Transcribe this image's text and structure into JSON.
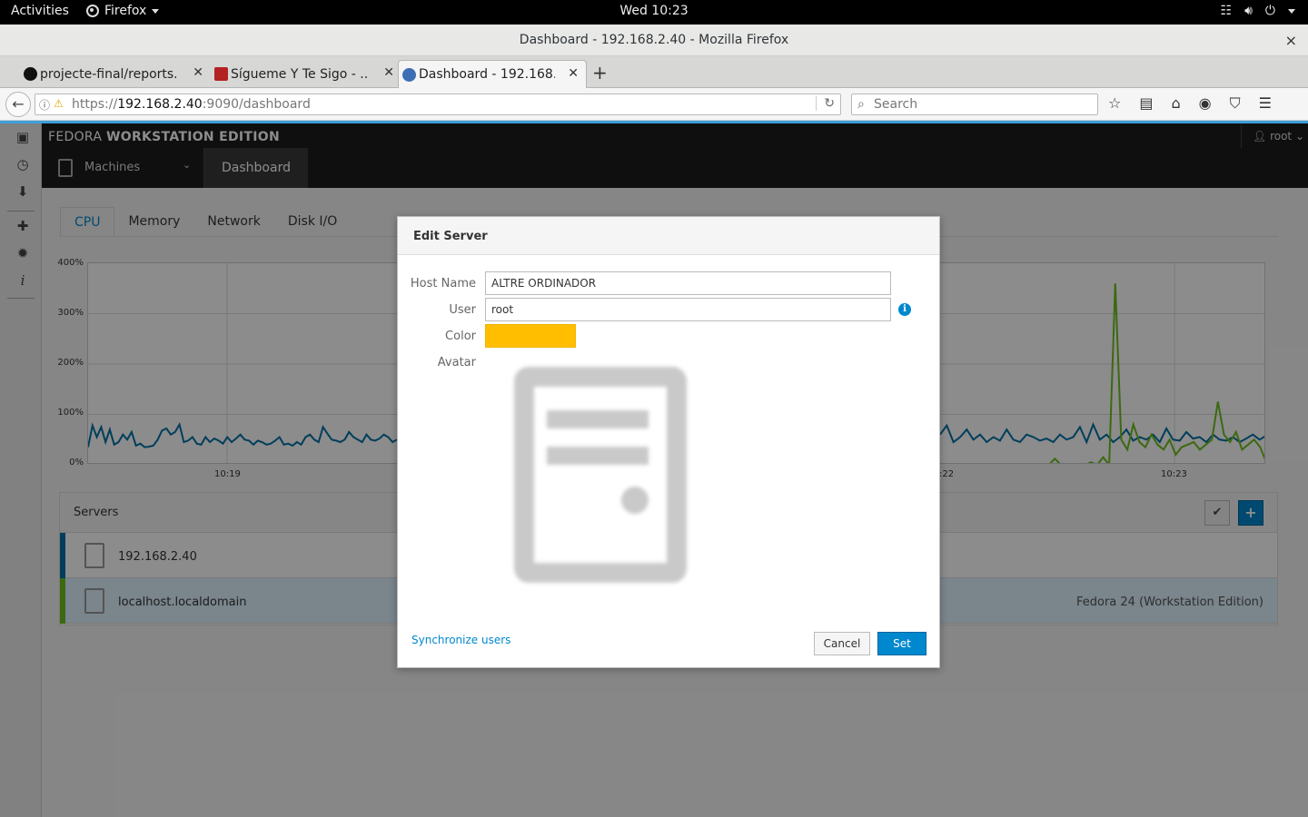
{
  "topbar": {
    "activities": "Activities",
    "app": "Firefox",
    "clock": "Wed 10:23"
  },
  "window": {
    "title": "Dashboard - 192.168.2.40 - Mozilla Firefox",
    "close": "×"
  },
  "tabs": [
    {
      "label": "projecte-final/reports...",
      "favicon": "github-icon",
      "color": "#111111"
    },
    {
      "label": "Sígueme Y Te Sigo - ...",
      "favicon": "site-icon",
      "color": "#b22222"
    },
    {
      "label": "Dashboard - 192.168....",
      "favicon": "fedora-icon",
      "color": "#3c6eb4"
    }
  ],
  "navbar": {
    "url_prefix": "https://",
    "url_host": "192.168.2.40",
    "url_rest": ":9090/dashboard",
    "search_placeholder": "Search"
  },
  "cockpit": {
    "brand_light": "FEDORA ",
    "brand_bold": "WORKSTATION EDITION",
    "user": "root",
    "machines": "Machines",
    "dashboard": "Dashboard",
    "content_tabs": [
      "CPU",
      "Memory",
      "Network",
      "Disk I/O"
    ],
    "active_tab": "CPU"
  },
  "chart_data": {
    "type": "line",
    "y_ticks": [
      "400%",
      "300%",
      "200%",
      "100%",
      "0%"
    ],
    "x_ticks": [
      "10:19",
      ":22",
      "10:23"
    ],
    "ylim": [
      0,
      400
    ],
    "series": [
      {
        "name": "192.168.2.40",
        "color": "#0071a6",
        "left_values": [
          35,
          78,
          55,
          75,
          45,
          70,
          40,
          45,
          60,
          50,
          65,
          38,
          42,
          35,
          36,
          38,
          50,
          68,
          72,
          60,
          65,
          80,
          45,
          48,
          55,
          42,
          40,
          55,
          45,
          52,
          48,
          42,
          55,
          45,
          52,
          60,
          50,
          48,
          40,
          48,
          45,
          40,
          42,
          48,
          55,
          40,
          42,
          38,
          45,
          40,
          55,
          60,
          50,
          45,
          75,
          62,
          50,
          48,
          45,
          50,
          65,
          55,
          50,
          45,
          60,
          50,
          48,
          52,
          60,
          55,
          45,
          50
        ],
        "right_values": [
          60,
          78,
          45,
          55,
          70,
          50,
          60,
          45,
          55,
          48,
          70,
          50,
          45,
          60,
          55,
          48,
          52,
          45,
          60,
          50,
          55,
          75,
          45,
          80,
          50,
          60,
          45,
          55,
          70,
          48,
          55,
          50,
          60,
          45,
          72,
          50,
          48,
          65,
          52,
          55,
          45,
          60,
          50,
          48,
          55,
          45,
          52,
          60,
          50,
          58
        ]
      },
      {
        "name": "localhost.localdomain",
        "color": "#6ec01e",
        "left_values": [
          0,
          0,
          0,
          0,
          0,
          0,
          0,
          0,
          0,
          0,
          0,
          0,
          0,
          0,
          0,
          0,
          0,
          0,
          0,
          0,
          0,
          0,
          0,
          0,
          0,
          0,
          0,
          0,
          0,
          0,
          0,
          0,
          0,
          0,
          0,
          0,
          0,
          0,
          0,
          0,
          0,
          0,
          0,
          0,
          0,
          0,
          0,
          0,
          0,
          0,
          0,
          0,
          0,
          0,
          0,
          0,
          0,
          0,
          0,
          0,
          0,
          0,
          0,
          0,
          0,
          0,
          0,
          0,
          0,
          0,
          0,
          0
        ],
        "right_values": [
          0,
          0,
          0,
          0,
          0,
          0,
          0,
          0,
          0,
          0,
          0,
          0,
          0,
          0,
          0,
          2,
          0,
          0,
          0,
          12,
          0,
          0,
          0,
          0,
          0,
          5,
          0,
          15,
          0,
          360,
          50,
          30,
          80,
          45,
          35,
          60,
          40,
          30,
          50,
          20,
          35,
          40,
          45,
          30,
          40,
          50,
          125,
          60,
          45,
          65,
          30,
          40,
          50,
          35,
          5
        ]
      }
    ],
    "grid": true
  },
  "servers": {
    "title": "Servers",
    "rows": [
      {
        "name": "192.168.2.40",
        "color": "#0071a6",
        "os": ""
      },
      {
        "name": "localhost.localdomain",
        "color": "#6ec01e",
        "os": "Fedora 24 (Workstation Edition)"
      }
    ]
  },
  "modal": {
    "title": "Edit Server",
    "host_label": "Host Name",
    "host_value": "ALTRE ORDINADOR",
    "user_label": "User",
    "user_value": "root",
    "color_label": "Color",
    "color_value": "#ffbf00",
    "avatar_label": "Avatar",
    "sync_link": "Synchronize users",
    "cancel": "Cancel",
    "set": "Set"
  }
}
